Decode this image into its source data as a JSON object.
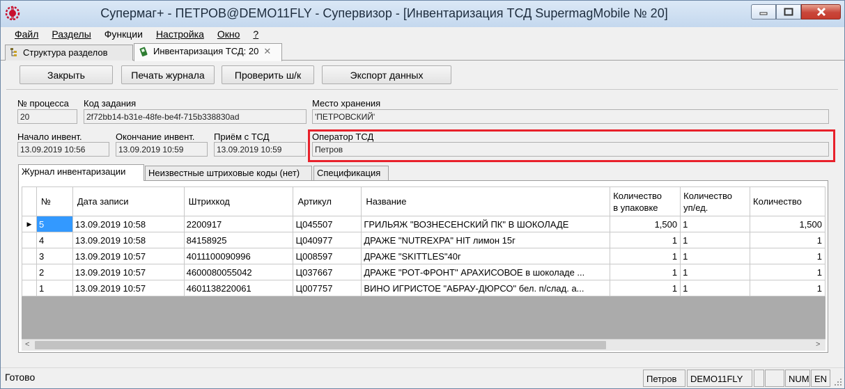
{
  "window": {
    "title": "Супермаг+ - ПЕТРОВ@DEMO11FLY - Супервизор  - [Инвентаризация ТСД SupermagMobile № 20]"
  },
  "menu": [
    "Файл",
    "Разделы",
    "Функции",
    "Настройка",
    "Окно",
    "?"
  ],
  "doc_tabs": [
    {
      "label": "Структура разделов"
    },
    {
      "label": "Инвентаризация ТСД: 20"
    }
  ],
  "toolbar": {
    "close_label": "Закрыть",
    "print_label": "Печать журнала",
    "check_label": "Проверить ш/к",
    "export_label": "Экспорт данных"
  },
  "fields": {
    "process_no_label": "№ процесса",
    "process_no_value": "20",
    "task_code_label": "Код задания",
    "task_code_value": "2f72bb14-b31e-48fe-be4f-715b338830ad",
    "storage_label": "Место хранения",
    "storage_value": "'ПЕТРОВСКИЙ'",
    "start_label": "Начало инвент.",
    "start_value": "13.09.2019 10:56",
    "end_label": "Окончание инвент.",
    "end_value": "13.09.2019 10:59",
    "receive_label": "Приём с ТСД",
    "receive_value": "13.09.2019 10:59",
    "operator_label": "Оператор ТСД",
    "operator_value": "Петров"
  },
  "inner_tabs": [
    "Журнал инвентаризации",
    "Неизвестные штриховые коды (нет)",
    "Спецификация"
  ],
  "grid": {
    "headers": [
      "№",
      "Дата записи",
      "Штрихкод",
      "Артикул",
      "Название",
      "Количество\nв упаковке",
      "Количество\nуп/ед.",
      "Количество"
    ],
    "rows": [
      [
        "5",
        "13.09.2019 10:58",
        "2200917",
        "Ц045507",
        "ГРИЛЬЯЖ \"ВОЗНЕСЕНСКИЙ ПК\" В ШОКОЛАДЕ",
        "1,500",
        "1",
        "1,500"
      ],
      [
        "4",
        "13.09.2019 10:58",
        "84158925",
        "Ц040977",
        "ДРАЖЕ \"NUTREXPA\" HIT лимон 15г",
        "1",
        "1",
        "1"
      ],
      [
        "3",
        "13.09.2019 10:57",
        "4011100090996",
        "Ц008597",
        "ДРАЖЕ \"SKITTLES\"40г",
        "1",
        "1",
        "1"
      ],
      [
        "2",
        "13.09.2019 10:57",
        "4600080055042",
        "Ц037667",
        "ДРАЖЕ \"РОТ-ФРОНТ\" АРАХИСОВОЕ в шоколаде ...",
        "1",
        "1",
        "1"
      ],
      [
        "1",
        "13.09.2019 10:57",
        "4601138220061",
        "Ц007757",
        "ВИНО ИГРИСТОЕ \"АБРАУ-ДЮРСО\" бел. п/слад. а...",
        "1",
        "1",
        "1"
      ]
    ]
  },
  "statusbar": {
    "status": "Готово",
    "user": "Петров",
    "db": "DEMO11FLY",
    "num": "NUM",
    "lang": "EN"
  },
  "colors": {
    "highlight": "#e8212b",
    "selection": "#3399ff"
  }
}
